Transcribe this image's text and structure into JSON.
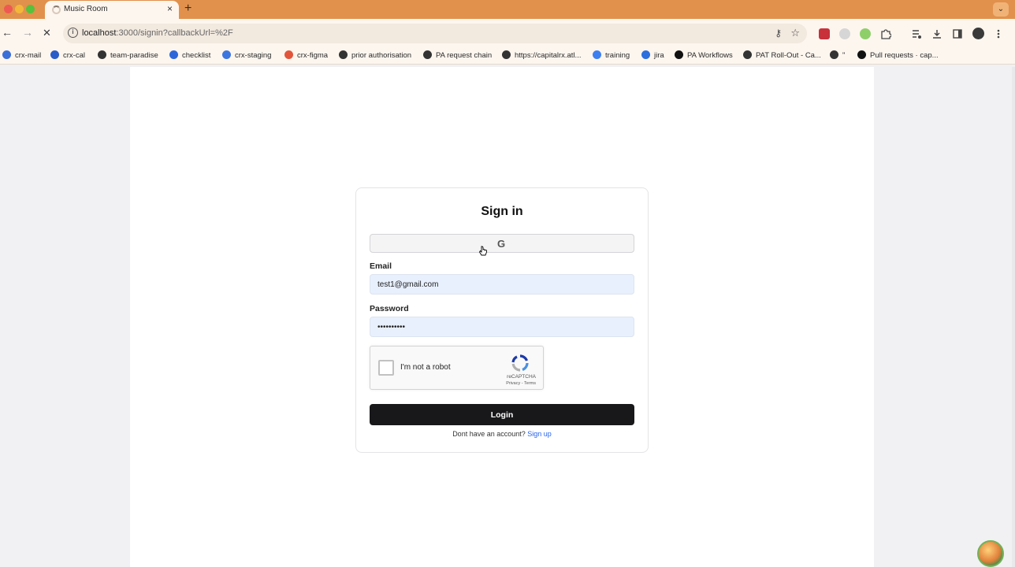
{
  "browser": {
    "tab_title": "Music Room",
    "tab_close": "×",
    "new_tab": "+",
    "tabstrip_menu": "⌄",
    "url_host": "localhost",
    "url_rest": ":3000/signin?callbackUrl=%2F",
    "icons": {
      "back": "←",
      "forward": "→",
      "stop": "✕",
      "info": "i",
      "key": "⚷",
      "star": "☆"
    },
    "bookmarks": [
      {
        "label": "crx-mail",
        "color": "#3a6fd8"
      },
      {
        "label": "crx-cal",
        "color": "#2a5cc8"
      },
      {
        "label": "team-paradise",
        "color": "#333333"
      },
      {
        "label": "checklist",
        "color": "#2e66d9"
      },
      {
        "label": "crx-staging",
        "color": "#3b76e0"
      },
      {
        "label": "crx-figma",
        "color": "#e2553b"
      },
      {
        "label": "prior authorisation",
        "color": "#333333"
      },
      {
        "label": "PA request chain",
        "color": "#333333"
      },
      {
        "label": "https://capitalrx.atl...",
        "color": "#333333"
      },
      {
        "label": "training",
        "color": "#3d7ff0"
      },
      {
        "label": "jira",
        "color": "#2c6fdd"
      },
      {
        "label": "PA Workflows",
        "color": "#111111"
      },
      {
        "label": "PAT Roll-Out - Ca...",
        "color": "#333333"
      },
      {
        "label": "\"",
        "color": "#333333"
      },
      {
        "label": "Pull requests · cap...",
        "color": "#111111"
      }
    ]
  },
  "signin": {
    "title": "Sign in",
    "google_icon": "G",
    "email_label": "Email",
    "email_value": "test1@gmail.com",
    "password_label": "Password",
    "password_value": "••••••••••",
    "captcha_label": "I'm not a robot",
    "captcha_brand": "reCAPTCHA",
    "captcha_terms": "Privacy - Terms",
    "login_label": "Login",
    "signup_prompt": "Dont have an account?",
    "signup_link": "Sign up"
  },
  "colors": {
    "tabstrip": "#e1914c",
    "login_button": "#18181b",
    "link": "#2563eb",
    "autofill": "#e8f0fe"
  }
}
